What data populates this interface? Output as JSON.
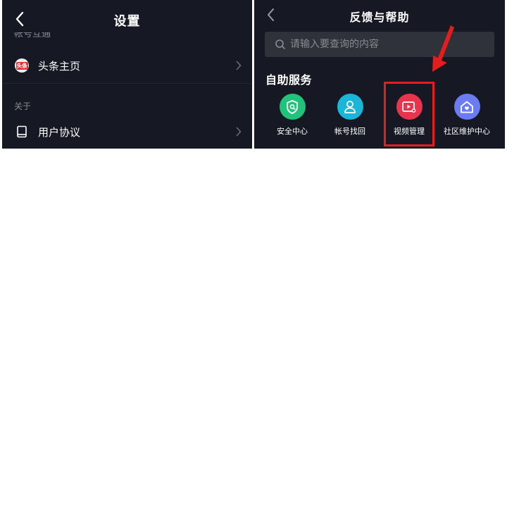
{
  "left": {
    "title": "设置",
    "cut_section_label": "帐号互通",
    "homepage": {
      "badge": "头条",
      "label": "头条主页"
    },
    "about_label": "关于",
    "agreement": {
      "label": "用户协议"
    }
  },
  "right": {
    "title": "反馈与帮助",
    "search_placeholder": "请输入要查询的内容",
    "service_title": "自助服务",
    "services": [
      {
        "label": "安全中心",
        "icon": "shield-icon",
        "color": "#20c37a"
      },
      {
        "label": "帐号找回",
        "icon": "person-icon",
        "color": "#1ab6d8"
      },
      {
        "label": "视频管理",
        "icon": "video-icon",
        "color": "#e8344c"
      },
      {
        "label": "社区维护中心",
        "icon": "house-heart-icon",
        "color": "#6b7cf3"
      }
    ]
  },
  "colors": {
    "background": "#161823",
    "search_bg": "#2f313b",
    "highlight": "#e61d1d"
  }
}
